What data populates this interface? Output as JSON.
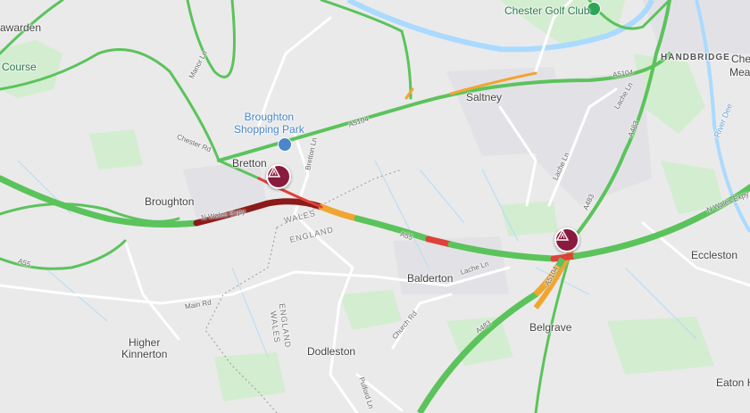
{
  "map": {
    "places": {
      "hawarden": "awarden",
      "course": "Course",
      "chester_golf_club": "Chester Golf Club",
      "handbridge": "HANDBRIDGE",
      "chester_partial": "Che",
      "mea_partial": "Mea",
      "saltney": "Saltney",
      "broughton_shopping_park": "Broughton\nShopping Park",
      "bretton": "Bretton",
      "broughton": "Broughton",
      "wales": "WALES",
      "england": "ENGLAND",
      "balderton": "Balderton",
      "eccleston": "Eccleston",
      "belgrave": "Belgrave",
      "higher_kinnerton": "Higher\nKinnerton",
      "dodleston": "Dodleston",
      "eaton": "Eaton H",
      "england_wales_border": "ENGLAND\nWALES",
      "river_dee": "River Dee"
    },
    "roads": {
      "manor_ln": "Manor Ln",
      "chester_rd": "Chester Rd",
      "a5104": "A5104",
      "bretton_ln": "Bretton Ln",
      "lache_ln": "Lache Ln",
      "lache_ln_2": "Lache Ln",
      "a483": "A483",
      "a5104_east": "A5104",
      "a55": "A55",
      "n_wales_expy": "N Wales Expy",
      "n_wales_expy_east": "N Wales Expy",
      "a483_south": "A483",
      "a55_west": "A55",
      "main_rd": "Main Rd",
      "church_rd": "Church Rd",
      "pulford_ln": "Pulford Ln",
      "a5104_mid": "A5104",
      "a483_north": "A483"
    },
    "incidents": [
      {
        "type": "road-closure"
      },
      {
        "type": "road-closure"
      }
    ],
    "colors": {
      "traffic_fast": "#5bc35b",
      "traffic_medium": "#f1a531",
      "traffic_slow": "#e0403a",
      "traffic_heavy": "#8b1a1a",
      "incident": "#8a1a3e",
      "water": "#aadaff",
      "green_area": "#cfeccc",
      "background": "#eaeaea"
    }
  }
}
